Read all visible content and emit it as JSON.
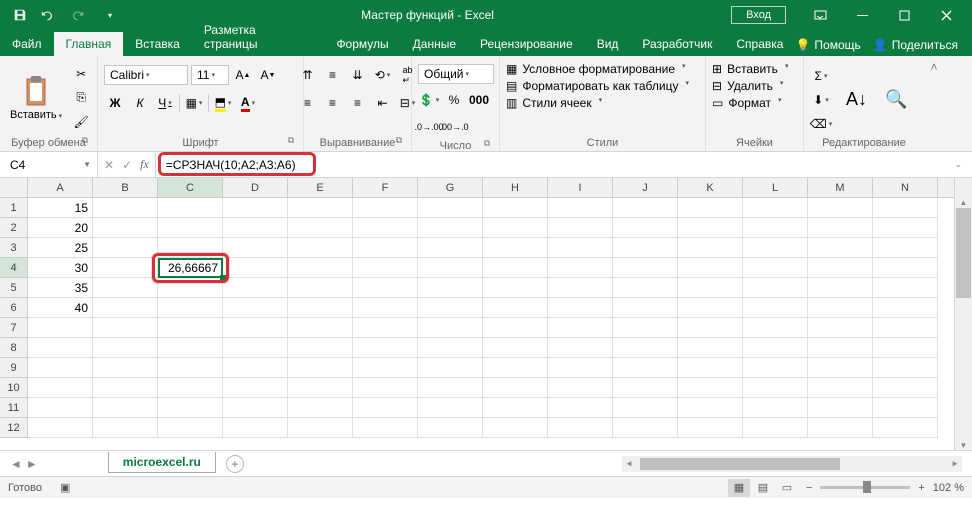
{
  "title": "Мастер функций  -  Excel",
  "signin": "Вход",
  "tabs": {
    "file": "Файл",
    "home": "Главная",
    "insert": "Вставка",
    "layout": "Разметка страницы",
    "formulas": "Формулы",
    "data": "Данные",
    "review": "Рецензирование",
    "view": "Вид",
    "developer": "Разработчик",
    "help": "Справка",
    "tellme": "Помощь",
    "share": "Поделиться"
  },
  "ribbon": {
    "clipboard": {
      "label": "Буфер обмена",
      "paste": "Вставить"
    },
    "font": {
      "label": "Шрифт",
      "name": "Calibri",
      "size": "11",
      "bold": "Ж",
      "italic": "К",
      "underline": "Ч"
    },
    "alignment": {
      "label": "Выравнивание"
    },
    "number": {
      "label": "Число",
      "format": "Общий"
    },
    "styles": {
      "label": "Стили",
      "conditional": "Условное форматирование",
      "table": "Форматировать как таблицу",
      "cellstyles": "Стили ячеек"
    },
    "cells": {
      "label": "Ячейки",
      "insert": "Вставить",
      "delete": "Удалить",
      "format": "Формат"
    },
    "editing": {
      "label": "Редактирование"
    }
  },
  "fx": {
    "cell_ref": "C4",
    "formula": "=СРЗНАЧ(10;A2;A3:A6)"
  },
  "columns": [
    "A",
    "B",
    "C",
    "D",
    "E",
    "F",
    "G",
    "H",
    "I",
    "J",
    "K",
    "L",
    "M",
    "N"
  ],
  "grid": {
    "a1": "15",
    "a2": "20",
    "a3": "25",
    "a4": "30",
    "a5": "35",
    "a6": "40",
    "c4": "26,66667"
  },
  "selected_col": "C",
  "selected_row": 4,
  "sheet": {
    "name": "microexcel.ru"
  },
  "status": {
    "ready": "Готово",
    "zoom": "102 %"
  }
}
